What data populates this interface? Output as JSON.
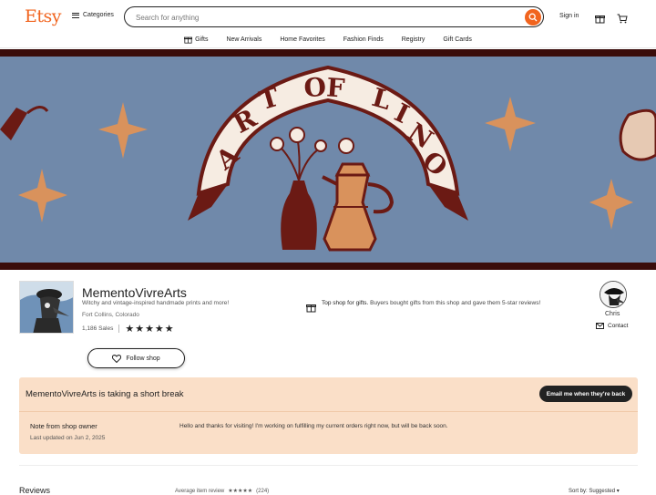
{
  "header": {
    "logo": "Etsy",
    "categories_label": "Categories",
    "search_placeholder": "Search for anything",
    "signin_label": "Sign in"
  },
  "nav": {
    "items": [
      {
        "label": "Gifts",
        "icon": "gift-icon"
      },
      {
        "label": "New Arrivals"
      },
      {
        "label": "Home Favorites"
      },
      {
        "label": "Fashion Finds"
      },
      {
        "label": "Registry"
      },
      {
        "label": "Gift Cards"
      }
    ]
  },
  "banner": {
    "art_text": "ART OF LINO",
    "colors": {
      "background": "#7089aa",
      "frame": "#3a0d0b",
      "accent": "#d9925c",
      "ink": "#6b1a14"
    }
  },
  "shop": {
    "name": "MementoVivreArts",
    "tagline": "Witchy and vintage-inspired handmade prints and more!",
    "location": "Fort Collins, Colorado",
    "sales": "1,186 Sales",
    "rating": 5,
    "stars": "★★★★★",
    "follow_label": "Follow shop",
    "top_shop_bold": "Top shop for gifts.",
    "top_shop_text": "Buyers bought gifts from this shop and gave them 5-star reviews!"
  },
  "owner": {
    "name": "Chris",
    "contact_label": "Contact"
  },
  "notice": {
    "title": "MementoVivreArts is taking a short break",
    "email_button": "Email me when they're back",
    "note_title": "Note from shop owner",
    "note_updated": "Last updated on Jun 2, 2025",
    "note_message": "Hello and thanks for visiting! I'm working on fulfilling my current orders right now, but will be back soon."
  },
  "reviews": {
    "title": "Reviews",
    "average_label": "Average item review",
    "average_stars": "★★★★★",
    "count": "(224)",
    "sort_label": "Sort by: Suggested ▾"
  }
}
